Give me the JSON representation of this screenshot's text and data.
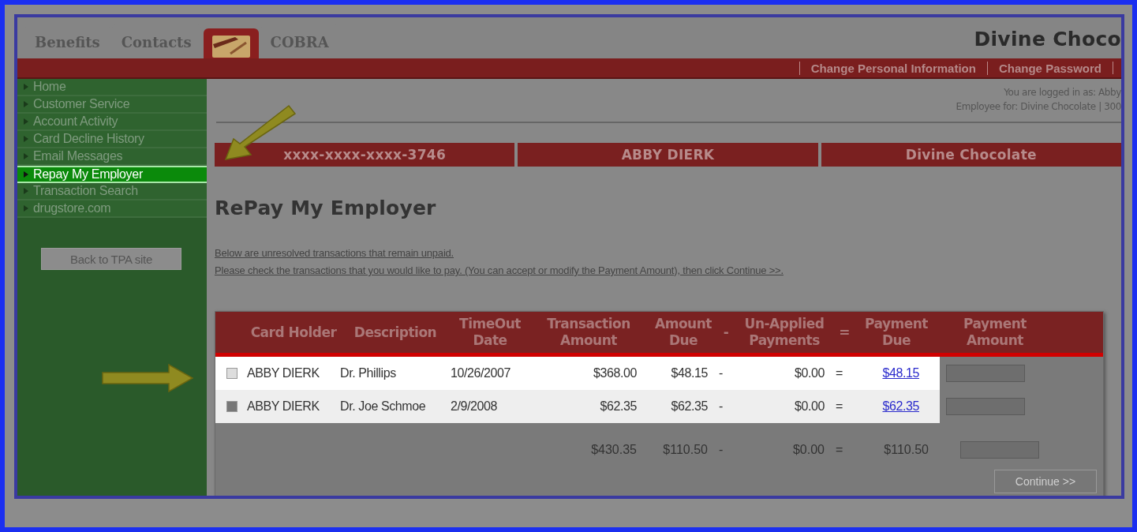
{
  "tabs": [
    {
      "kind": "text",
      "label": "Benefits",
      "selected": false
    },
    {
      "kind": "text",
      "label": "Contacts",
      "selected": false
    },
    {
      "kind": "card",
      "selected": true
    },
    {
      "kind": "text",
      "label": "COBRA",
      "selected": false
    }
  ],
  "brand": "Divine Choco",
  "top_links": [
    "Change Personal Information",
    "Change Password"
  ],
  "sidebar": {
    "items": [
      {
        "label": "Home",
        "selected": false
      },
      {
        "label": "Customer Service",
        "selected": false
      },
      {
        "label": "Account Activity",
        "selected": false
      },
      {
        "label": "Card Decline History",
        "selected": false
      },
      {
        "label": "Email Messages",
        "selected": false
      },
      {
        "label": "Repay My Employer",
        "selected": true
      },
      {
        "label": "Transaction Search",
        "selected": false
      },
      {
        "label": "drugstore.com",
        "selected": false
      }
    ],
    "button": "Back to TPA site"
  },
  "login": {
    "line_1": "You are logged in as: Abby",
    "line_2": "Employee for: Divine Chocolate | 300"
  },
  "card_strip": [
    "xxxx-xxxx-xxxx-3746",
    "ABBY DIERK",
    "Divine Chocolate"
  ],
  "heading": "RePay My Employer",
  "instructions": [
    "Below are unresolved transactions that remain unpaid.",
    "Please check the transactions that you would like to pay. (You can accept or modify the Payment Amount), then click Continue >>."
  ],
  "table": {
    "columns": [
      "Card Holder",
      "Description",
      "TimeOut Date",
      "Transaction Amount",
      "Amount Due",
      "-",
      "Un-Applied Payments",
      "=",
      "Payment Due",
      "Payment Amount"
    ],
    "rows": [
      {
        "checked": false,
        "cells": [
          "ABBY DIERK",
          "Dr. Phillips",
          "10/26/2007",
          "$368.00",
          "$48.15",
          "-",
          "$0.00",
          "=",
          "$48.15"
        ]
      },
      {
        "checked": true,
        "cells": [
          "ABBY DIERK",
          "Dr. Joe Schmoe",
          "2/9/2008",
          "$62.35",
          "$62.35",
          "-",
          "$0.00",
          "=",
          "$62.35"
        ]
      }
    ],
    "totals": [
      "$430.35",
      "$110.50",
      "-",
      "$0.00",
      "=",
      "$110.50"
    ],
    "button": "Continue >>"
  }
}
